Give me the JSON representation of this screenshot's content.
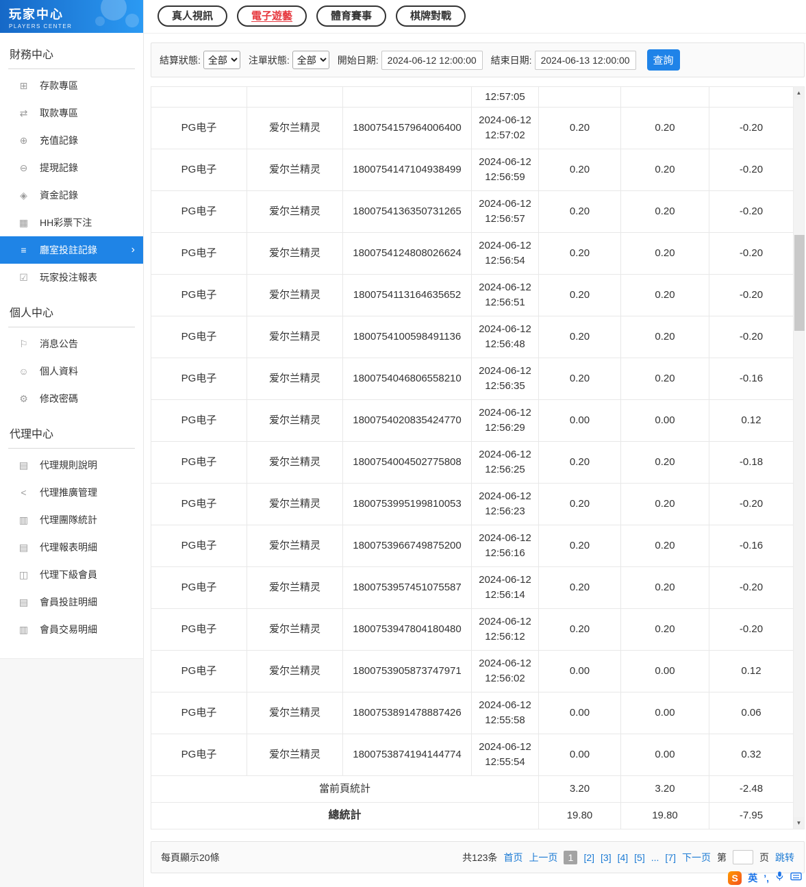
{
  "sidebar": {
    "title": "玩家中心",
    "subtitle": "PLAYERS CENTER",
    "sections": [
      {
        "title": "財務中心",
        "items": [
          {
            "label": "存款專區",
            "icon": "deposit-icon",
            "glyph": "⊞"
          },
          {
            "label": "取款專區",
            "icon": "withdraw-icon",
            "glyph": "⇄"
          },
          {
            "label": "充值記錄",
            "icon": "recharge-record-icon",
            "glyph": "⊕"
          },
          {
            "label": "提現記錄",
            "icon": "cashout-record-icon",
            "glyph": "⊖"
          },
          {
            "label": "資金記錄",
            "icon": "funds-record-icon",
            "glyph": "◈"
          },
          {
            "label": "HH彩票下注",
            "icon": "lottery-bet-icon",
            "glyph": "▦"
          },
          {
            "label": "廳室投註記錄",
            "icon": "room-bet-records-icon",
            "glyph": "≡",
            "active": true,
            "chevron": "›"
          },
          {
            "label": "玩家投注報表",
            "icon": "player-bet-report-icon",
            "glyph": "☑"
          }
        ]
      },
      {
        "title": "個人中心",
        "items": [
          {
            "label": "消息公告",
            "icon": "announcement-bell-icon",
            "glyph": "⚐"
          },
          {
            "label": "個人資料",
            "icon": "profile-user-icon",
            "glyph": "☺"
          },
          {
            "label": "修改密碼",
            "icon": "password-gear-icon",
            "glyph": "⚙"
          }
        ]
      },
      {
        "title": "代理中心",
        "items": [
          {
            "label": "代理規則說明",
            "icon": "agent-rules-doc-icon",
            "glyph": "▤"
          },
          {
            "label": "代理推廣管理",
            "icon": "agent-promotion-share-icon",
            "glyph": "<"
          },
          {
            "label": "代理團隊統計",
            "icon": "agent-team-stats-icon",
            "glyph": "▥"
          },
          {
            "label": "代理報表明細",
            "icon": "agent-report-detail-icon",
            "glyph": "▤"
          },
          {
            "label": "代理下級會員",
            "icon": "agent-sub-members-icon",
            "glyph": "◫"
          },
          {
            "label": "會員投註明細",
            "icon": "member-bet-detail-icon",
            "glyph": "▤"
          },
          {
            "label": "會員交易明細",
            "icon": "member-transaction-detail-icon",
            "glyph": "▥"
          }
        ]
      }
    ]
  },
  "tabs": [
    {
      "label": "真人視訊"
    },
    {
      "label": "電子遊藝",
      "active": true
    },
    {
      "label": "體育賽事"
    },
    {
      "label": "棋牌對戰"
    }
  ],
  "filters": {
    "settle_status_label": "結算狀態:",
    "settle_status_value": "全部",
    "order_status_label": "注單狀態:",
    "order_status_value": "全部",
    "start_date_label": "開始日期:",
    "start_date_value": "2024-06-12 12:00:00",
    "end_date_label": "結束日期:",
    "end_date_value": "2024-06-13 12:00:00",
    "search_button": "查詢"
  },
  "table": {
    "rows": [
      {
        "platform": "",
        "game": "",
        "order_no": "",
        "time": "12:57:05",
        "bet": "",
        "valid_bet": "",
        "profit": ""
      },
      {
        "platform": "PG电子",
        "game": "爱尔兰精灵",
        "order_no": "1800754157964006400",
        "time": "2024-06-12 12:57:02",
        "bet": "0.20",
        "valid_bet": "0.20",
        "profit": "-0.20"
      },
      {
        "platform": "PG电子",
        "game": "爱尔兰精灵",
        "order_no": "1800754147104938499",
        "time": "2024-06-12 12:56:59",
        "bet": "0.20",
        "valid_bet": "0.20",
        "profit": "-0.20"
      },
      {
        "platform": "PG电子",
        "game": "爱尔兰精灵",
        "order_no": "1800754136350731265",
        "time": "2024-06-12 12:56:57",
        "bet": "0.20",
        "valid_bet": "0.20",
        "profit": "-0.20"
      },
      {
        "platform": "PG电子",
        "game": "爱尔兰精灵",
        "order_no": "1800754124808026624",
        "time": "2024-06-12 12:56:54",
        "bet": "0.20",
        "valid_bet": "0.20",
        "profit": "-0.20"
      },
      {
        "platform": "PG电子",
        "game": "爱尔兰精灵",
        "order_no": "1800754113164635652",
        "time": "2024-06-12 12:56:51",
        "bet": "0.20",
        "valid_bet": "0.20",
        "profit": "-0.20"
      },
      {
        "platform": "PG电子",
        "game": "爱尔兰精灵",
        "order_no": "1800754100598491136",
        "time": "2024-06-12 12:56:48",
        "bet": "0.20",
        "valid_bet": "0.20",
        "profit": "-0.20"
      },
      {
        "platform": "PG电子",
        "game": "爱尔兰精灵",
        "order_no": "1800754046806558210",
        "time": "2024-06-12 12:56:35",
        "bet": "0.20",
        "valid_bet": "0.20",
        "profit": "-0.16"
      },
      {
        "platform": "PG电子",
        "game": "爱尔兰精灵",
        "order_no": "1800754020835424770",
        "time": "2024-06-12 12:56:29",
        "bet": "0.00",
        "valid_bet": "0.00",
        "profit": "0.12"
      },
      {
        "platform": "PG电子",
        "game": "爱尔兰精灵",
        "order_no": "1800754004502775808",
        "time": "2024-06-12 12:56:25",
        "bet": "0.20",
        "valid_bet": "0.20",
        "profit": "-0.18"
      },
      {
        "platform": "PG电子",
        "game": "爱尔兰精灵",
        "order_no": "1800753995199810053",
        "time": "2024-06-12 12:56:23",
        "bet": "0.20",
        "valid_bet": "0.20",
        "profit": "-0.20"
      },
      {
        "platform": "PG电子",
        "game": "爱尔兰精灵",
        "order_no": "1800753966749875200",
        "time": "2024-06-12 12:56:16",
        "bet": "0.20",
        "valid_bet": "0.20",
        "profit": "-0.16"
      },
      {
        "platform": "PG电子",
        "game": "爱尔兰精灵",
        "order_no": "1800753957451075587",
        "time": "2024-06-12 12:56:14",
        "bet": "0.20",
        "valid_bet": "0.20",
        "profit": "-0.20"
      },
      {
        "platform": "PG电子",
        "game": "爱尔兰精灵",
        "order_no": "1800753947804180480",
        "time": "2024-06-12 12:56:12",
        "bet": "0.20",
        "valid_bet": "0.20",
        "profit": "-0.20"
      },
      {
        "platform": "PG电子",
        "game": "爱尔兰精灵",
        "order_no": "1800753905873747971",
        "time": "2024-06-12 12:56:02",
        "bet": "0.00",
        "valid_bet": "0.00",
        "profit": "0.12"
      },
      {
        "platform": "PG电子",
        "game": "爱尔兰精灵",
        "order_no": "1800753891478887426",
        "time": "2024-06-12 12:55:58",
        "bet": "0.00",
        "valid_bet": "0.00",
        "profit": "0.06"
      },
      {
        "platform": "PG电子",
        "game": "爱尔兰精灵",
        "order_no": "1800753874194144774",
        "time": "2024-06-12 12:55:54",
        "bet": "0.00",
        "valid_bet": "0.00",
        "profit": "0.32"
      }
    ],
    "summary": [
      {
        "label": "當前頁統計",
        "bet": "3.20",
        "valid_bet": "3.20",
        "profit": "-2.48"
      },
      {
        "label": "總統計",
        "bet": "19.80",
        "valid_bet": "19.80",
        "profit": "-7.95"
      }
    ]
  },
  "pagination": {
    "page_size_text": "每頁顯示20條",
    "total_text": "共123条",
    "first_label": "首页",
    "prev_label": "上一页",
    "pages": [
      {
        "label": "1",
        "current": true
      },
      {
        "label": "[2]"
      },
      {
        "label": "[3]"
      },
      {
        "label": "[4]"
      },
      {
        "label": "[5]"
      },
      {
        "label": "..."
      },
      {
        "label": "[7]"
      }
    ],
    "next_label": "下一页",
    "jump_prefix": "第",
    "jump_suffix": "页",
    "jump_button": "跳转"
  },
  "ime": {
    "logo_text": "S",
    "lang_text": "英",
    "punct_text": "’,"
  }
}
